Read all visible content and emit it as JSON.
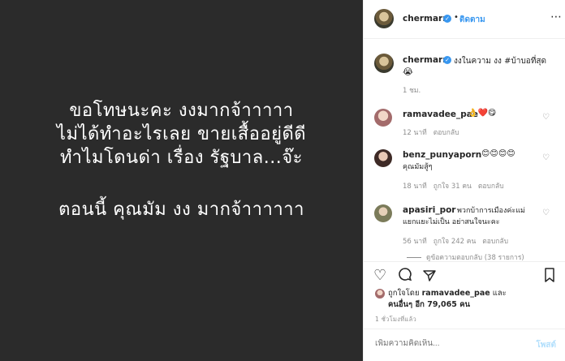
{
  "image": {
    "lines": [
      "ขอโทษนะคะ  งงมากจ้าาาาา",
      "ไม่ได้ทำอะไรเลย  ขายเสื้ออยู่ดีดี",
      "ทำไมโดนด่า  เรื่อง  รัฐบาล...จ๊ะ",
      "ตอนนี้  คุณมัม  งง  มากจ้าาาาาา"
    ]
  },
  "header": {
    "username": "chermarn",
    "dot": "•",
    "follow_label": "ติดตาม",
    "more_icon": "more-horizontal-icon"
  },
  "caption": {
    "username": "chermarn",
    "text": "งงในความ งง #บ้าบอที่สุด",
    "emoji": "😭",
    "time": "1 ชม."
  },
  "comments": [
    {
      "username": "ramavadee_pae",
      "text": "👌❤️😋",
      "time": "12 นาที",
      "reply": "ตอบกลับ",
      "likes": ""
    },
    {
      "username": "benz_punyaporn",
      "text": "😊😊😊😊",
      "text2": "คุณมัมสู้ๆ",
      "time": "18 นาที",
      "likes": "ถูกใจ 31 คน",
      "reply": "ตอบกลับ"
    },
    {
      "username": "apasiri_por",
      "text": "พวกบ้าการเมืองค่ะแม่",
      "text2": "แยกแยะไม่เป็น อย่าสนใจนะคะ",
      "time": "56 นาที",
      "likes": "ถูกใจ 242 คน",
      "reply": "ตอบกลับ"
    }
  ],
  "view_replies": "ดูข้อความตอบกลับ (38 รายการ)",
  "likes": {
    "prefix": "ถูกใจโดย",
    "user": "ramavadee_pae",
    "and": "และ",
    "others": "คนอื่นๆ อีก 79,065 คน"
  },
  "post_time": "1 ชั่วโมงที่แล้ว",
  "comment_input": {
    "placeholder": "เพิ่มความคิดเห็น..."
  },
  "post_button": "โพสต์",
  "colors": {
    "image_bg": "#2b2b2b",
    "accent": "#3897f0",
    "muted": "#8e8e8e"
  }
}
